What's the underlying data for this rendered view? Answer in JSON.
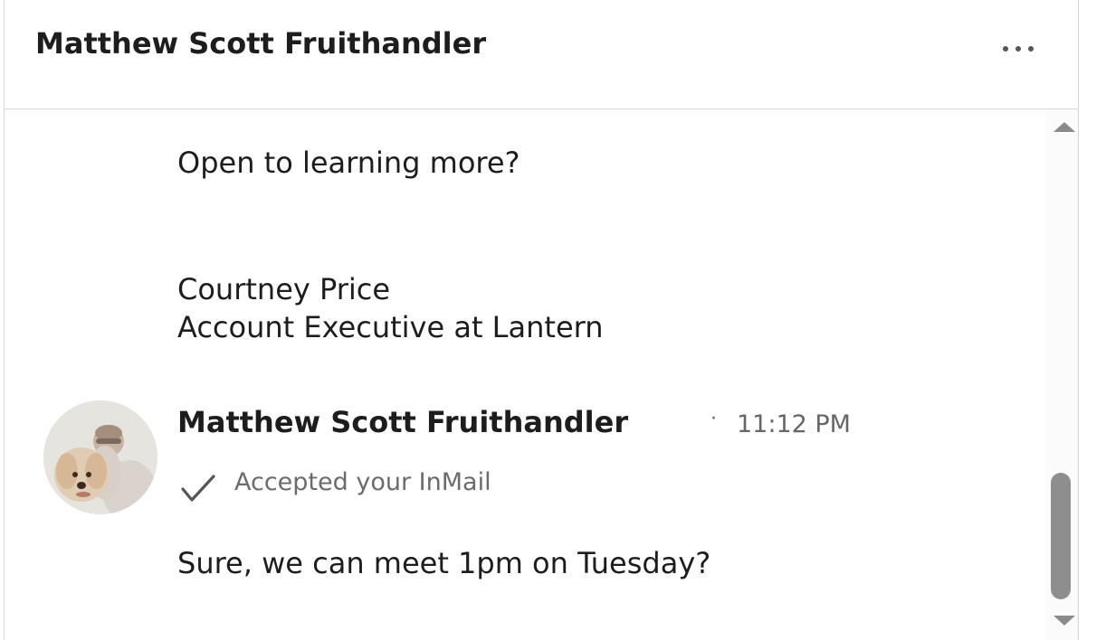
{
  "header": {
    "title": "Matthew Scott Fruithandler",
    "more_icon": "ellipsis-icon"
  },
  "thread": {
    "previous_message": {
      "question": "Open to learning more?",
      "signature_name": "Courtney Price",
      "signature_title": "Account Executive at Lantern"
    },
    "reply": {
      "sender": "Matthew Scott Fruithandler",
      "separator": "·",
      "time": "11:12 PM",
      "status_icon": "checkmark-icon",
      "status_text": "Accepted your InMail",
      "body": "Sure, we can meet 1pm on Tuesday?"
    }
  },
  "colors": {
    "text_primary": "#1d1d1d",
    "text_secondary": "#666666",
    "divider": "#d9d9d9",
    "scrollbar_thumb": "#8e8e8e"
  }
}
